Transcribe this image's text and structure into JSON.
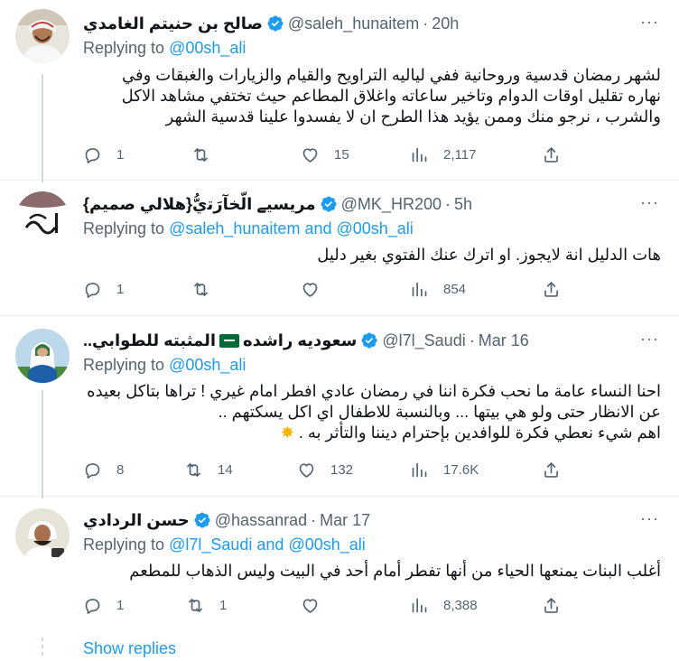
{
  "tweets": [
    {
      "name": "صالح بن حنيتم الغامدي",
      "handle": "@saleh_hunaitem",
      "time": "20h",
      "replying_prefix": "Replying to",
      "replying_to": "@00sh_ali",
      "body_lines": [
        "لشهر رمضان قدسية وروحانية  ففي لياليه التراويح والقيام  والزيارات والغبقات  وفي",
        "نهاره  تقليل اوقات الدوام  وتاخير ساعاته واغلاق المطاعم حيث تختفي مشاهد الاكل",
        "والشرب ، نرجو منك وممن يؤيد هذا الطرح ان لا يفسدوا علينا قدسية الشهر"
      ],
      "replies": "1",
      "retweets": "",
      "likes": "15",
      "views": "2,117"
    },
    {
      "name": "مريسيے اﻟّﺨﺂرَﺗيُّ{هلالي صميم}",
      "handle": "@MK_HR200",
      "time": "5h",
      "replying_prefix": "Replying to",
      "replying_to": "@saleh_hunaitem and @00sh_ali",
      "body_lines": [
        "هات الدليل انة لايجوز. او اترك عنك الفتوي بغير دليل"
      ],
      "replies": "1",
      "retweets": "",
      "likes": "",
      "views": "854"
    },
    {
      "name": "سعوديه راشده",
      "name_suffix": "..المثبته للطوابي",
      "handle": "@l7l_Saudi",
      "time": "Mar 16",
      "replying_prefix": "Replying to",
      "replying_to": "@00sh_ali",
      "body_lines": [
        "احنا النساء عامة ما نحب فكرة اننا في رمضان عادي افطر امام غيري ! تراها بتاكل بعيده",
        "عن الانظار حتى ولو هي بيتها ... وبالنسبة للاطفال اي اكل يسكتهم ..",
        "اهم شيء نعطي فكرة للوافدين بإحترام ديننا والتأثر به ."
      ],
      "replies": "8",
      "retweets": "14",
      "likes": "132",
      "views": "17.6K"
    },
    {
      "name": "حسن الردادي",
      "handle": "@hassanrad",
      "time": "Mar 17",
      "replying_prefix": "Replying to",
      "replying_to": "@l7l_Saudi and @00sh_ali",
      "body_lines": [
        "أغلب البنات يمنعها الحياء من أنها تفطر أمام أحد في البيت وليس الذهاب للمطعم"
      ],
      "replies": "1",
      "retweets": "1",
      "likes": "",
      "views": "8,388"
    }
  ],
  "more_label": "···",
  "show_replies": "Show replies",
  "colors": {
    "accent": "#1d9bf0",
    "muted": "#536471",
    "text": "#0f1419"
  }
}
